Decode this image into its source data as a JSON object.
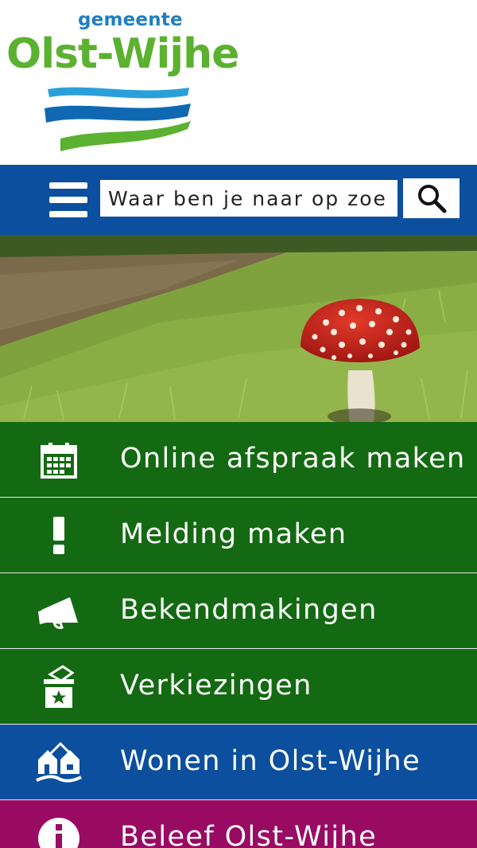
{
  "header": {
    "logo_small": "gemeente",
    "logo_big": "Olst-Wijhe"
  },
  "search": {
    "placeholder": "Waar ben je naar op zoe",
    "menu_icon": "hamburger-menu-icon",
    "search_icon": "magnifier-icon"
  },
  "hero": {
    "image": "mushroom-on-grass-path-photo"
  },
  "tiles": [
    {
      "label": "Online afspraak maken",
      "icon": "calendar-icon",
      "color": "#146a12"
    },
    {
      "label": "Melding maken",
      "icon": "exclamation-icon",
      "color": "#146a12"
    },
    {
      "label": "Bekendmakingen",
      "icon": "megaphone-icon",
      "color": "#146a12"
    },
    {
      "label": "Verkiezingen",
      "icon": "ballot-box-icon",
      "color": "#146a12"
    },
    {
      "label": "Wonen in Olst-Wijhe",
      "icon": "houses-icon",
      "color": "#0b4f9e"
    },
    {
      "label": "Beleef Olst-Wijhe",
      "icon": "info-icon",
      "color": "#990a63"
    }
  ],
  "colors": {
    "brand_blue": "#0b4f9e",
    "brand_green": "#146a12",
    "brand_purple": "#990a63",
    "logo_green": "#5bb130",
    "logo_blue": "#1e7fc2"
  }
}
